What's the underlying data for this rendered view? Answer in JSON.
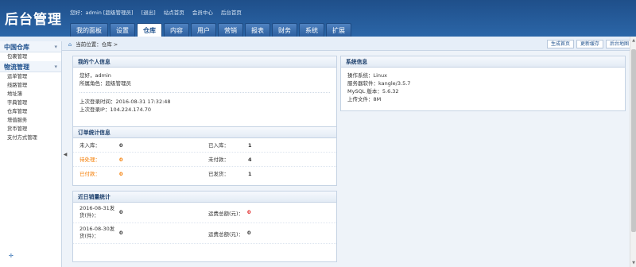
{
  "app": {
    "title": "后台管理"
  },
  "toplinks": [
    "您好：admin [超级管理员]",
    "[退出]",
    "站点首页",
    "会员中心",
    "后台首页"
  ],
  "nav": {
    "tabs": [
      "我的面板",
      "设置",
      "仓库",
      "内容",
      "用户",
      "营销",
      "报表",
      "财务",
      "系统",
      "扩展"
    ],
    "active_index": 2
  },
  "sidebar": {
    "groups": [
      {
        "label": "中国仓库",
        "items": [
          "包裹管理"
        ]
      },
      {
        "label": "物流管理",
        "items": [
          "运单管理",
          "线路管理",
          "地址簿",
          "字典管理",
          "仓库管理",
          "增值服务",
          "货币管理",
          "支付方式管理"
        ]
      }
    ]
  },
  "breadcrumb": "当前位置：仓库 >",
  "actions": [
    "生成首页",
    "更新缓存",
    "后台地图"
  ],
  "profile": {
    "title": "我的个人信息",
    "hello": "您好，admin",
    "role": "所属角色：超级管理员",
    "last_login_time": "上次登录时间：2016-08-31 17:32:48",
    "last_login_ip": "上次登录IP：104.224.174.70"
  },
  "orders": {
    "title": "订单统计信息",
    "rows": [
      {
        "l1": "未入库：",
        "v1": "0",
        "l2": "已入库：",
        "v2": "1"
      },
      {
        "l1": "待处理：",
        "v1": "0",
        "l2": "未付款：",
        "v2": "4"
      },
      {
        "l1": "已付款：",
        "v1": "0",
        "l2": "已发货：",
        "v2": "1"
      }
    ]
  },
  "sales": {
    "title": "近日销量统计",
    "rows": [
      {
        "date": "2016-08-31发货(件)：",
        "count": "0",
        "label": "运费总额(元)：",
        "amount": "0"
      },
      {
        "date": "2016-08-30发货(件)：",
        "count": "0",
        "label": "运费总额(元)：",
        "amount": "0"
      }
    ]
  },
  "system": {
    "title": "系统信息",
    "lines": [
      "操作系统：Linux",
      "服务器软件：kangle/3.5.7",
      "MySQL 版本：5.6.32",
      "上传文件：8M"
    ]
  },
  "colors": {
    "header": "#2b66a8",
    "accent": "#1c4f8c",
    "warn": "#f57c00",
    "alert": "#e02020"
  },
  "icons": {
    "home": "home-icon",
    "collapse": "arrow-left-icon"
  }
}
